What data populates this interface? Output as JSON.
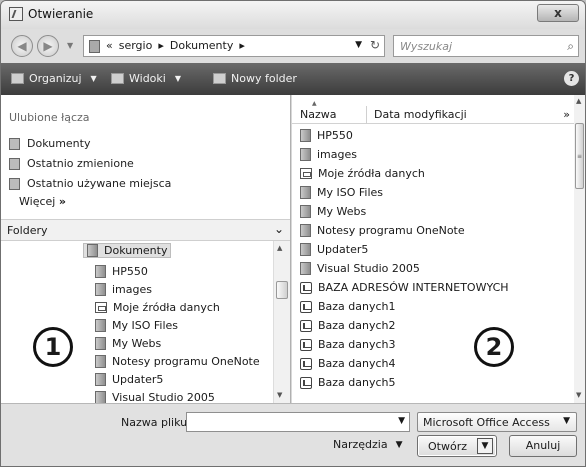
{
  "window": {
    "title": "Otwieranie",
    "close_label": "x"
  },
  "address": {
    "back_glyph": "◀",
    "forward_glyph": "▶",
    "crumbs": [
      "«",
      "sergio",
      "▸",
      "Dokumenty",
      "▸"
    ],
    "search_placeholder": "Wyszukaj"
  },
  "toolbar": {
    "organize": "Organizuj",
    "views": "Widoki",
    "new_folder": "Nowy folder",
    "help": "?"
  },
  "left_pane": {
    "favorites_heading": "Ulubione łącza",
    "favorites": [
      "Dokumenty",
      "Ostatnio zmienione",
      "Ostatnio używane miejsca"
    ],
    "more": "Więcej",
    "more_glyph": "»",
    "folders_label": "Foldery",
    "tree": [
      {
        "label": "Dokumenty",
        "icon": "folder-icon"
      },
      {
        "label": "HP550",
        "icon": "folder-icon"
      },
      {
        "label": "images",
        "icon": "folder-icon"
      },
      {
        "label": "Moje źródła danych",
        "icon": "data-source-icon"
      },
      {
        "label": "My ISO Files",
        "icon": "folder-icon"
      },
      {
        "label": "My Webs",
        "icon": "folder-icon"
      },
      {
        "label": "Notesy programu OneNote",
        "icon": "folder-icon"
      },
      {
        "label": "Updater5",
        "icon": "folder-icon"
      },
      {
        "label": "Visual Studio 2005",
        "icon": "folder-icon"
      }
    ]
  },
  "right_pane": {
    "columns": {
      "name": "Nazwa",
      "date": "Data modyfikacji",
      "more": "»"
    },
    "files": [
      {
        "label": "HP550",
        "icon": "folder-icon"
      },
      {
        "label": "images",
        "icon": "folder-icon"
      },
      {
        "label": "Moje źródła danych",
        "icon": "data-source-icon"
      },
      {
        "label": "My ISO Files",
        "icon": "folder-icon"
      },
      {
        "label": "My Webs",
        "icon": "folder-icon"
      },
      {
        "label": "Notesy programu OneNote",
        "icon": "folder-icon"
      },
      {
        "label": "Updater5",
        "icon": "folder-icon"
      },
      {
        "label": "Visual Studio 2005",
        "icon": "folder-icon"
      },
      {
        "label": "BAZA ADRESÓW INTERNETOWYCH",
        "icon": "access-db-icon"
      },
      {
        "label": "Baza danych1",
        "icon": "access-db-icon"
      },
      {
        "label": "Baza danych2",
        "icon": "access-db-icon"
      },
      {
        "label": "Baza danych3",
        "icon": "access-db-icon"
      },
      {
        "label": "Baza danych4",
        "icon": "access-db-icon"
      },
      {
        "label": "Baza danych5",
        "icon": "access-db-icon"
      }
    ]
  },
  "callouts": [
    "1",
    "2"
  ],
  "bottom": {
    "filename_label": "Nazwa pliku:",
    "filename_value": "",
    "filetype": "Microsoft Office Access",
    "tools": "Narzędzia",
    "open": "Otwórz",
    "cancel": "Anuluj"
  }
}
